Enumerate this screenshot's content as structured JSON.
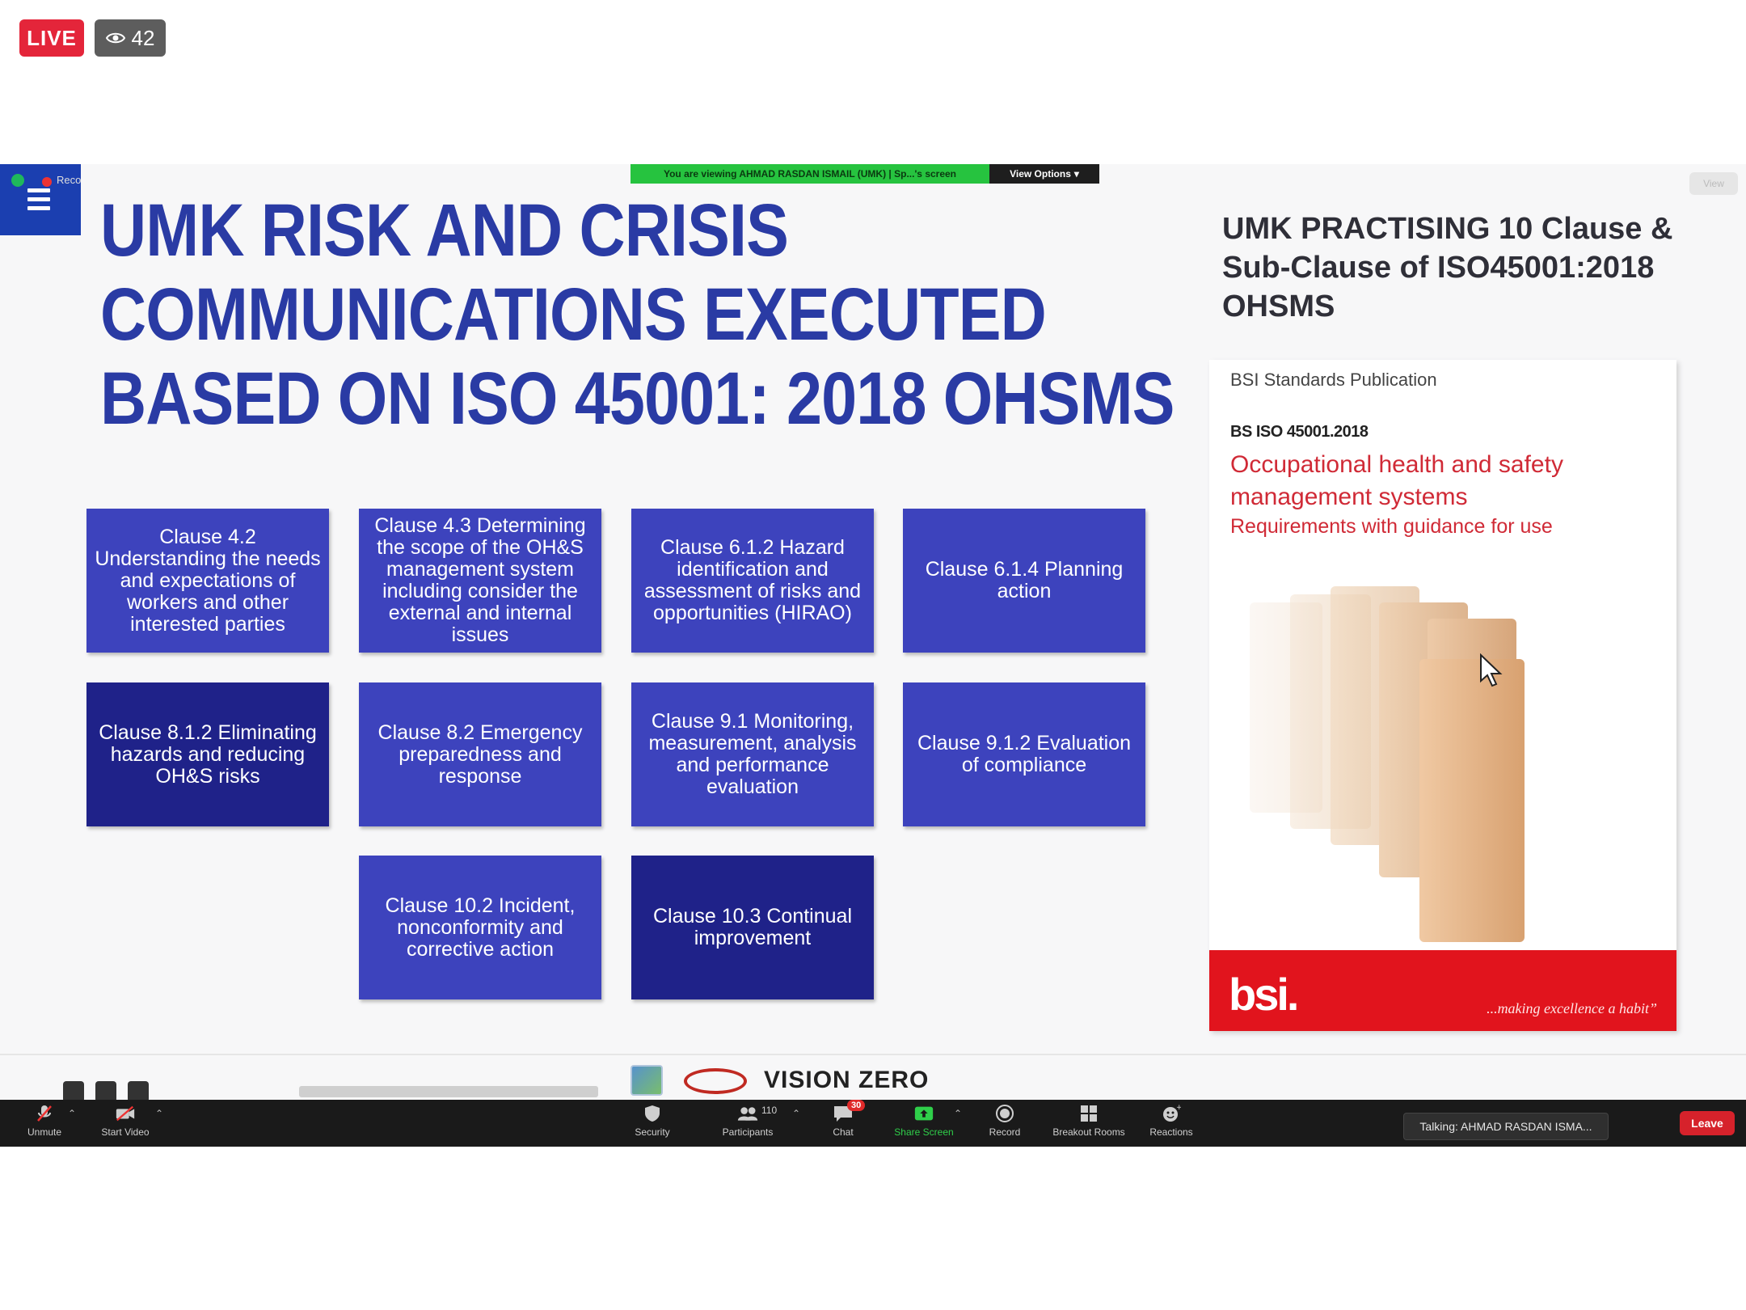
{
  "live": {
    "label": "LIVE",
    "viewers": "42"
  },
  "zoom": {
    "recording_label": "Reco",
    "viewing_banner": "You are viewing AHMAD RASDAN ISMAIL (UMK) | Sp...'s screen",
    "view_options": "View Options",
    "view_button": "View"
  },
  "slide": {
    "title_lines": [
      "UMK RISK AND CRISIS",
      "COMMUNICATIONS EXECUTED",
      "BASED ON  ISO 45001: 2018 OHSMS"
    ],
    "clauses": [
      "Clause 4.2 Understanding the needs and expectations of workers and other interested parties",
      "Clause 4.3 Determining the scope of the OH&S management system including consider the external and internal issues",
      "Clause 6.1.2 Hazard identification and assessment of risks and opportunities (HIRAO)",
      "Clause 6.1.4 Planning action",
      "Clause 8.1.2 Eliminating hazards and reducing OH&S risks",
      "Clause 8.2 Emergency preparedness and response",
      "Clause 9.1 Monitoring, measurement, analysis and performance evaluation",
      "Clause 9.1.2 Evaluation of compliance",
      "Clause 10.2 Incident, nonconformity and corrective action",
      "Clause 10.3 Continual improvement"
    ],
    "right_title": "UMK PRACTISING 10 Clause & Sub-Clause of ISO45001:2018 OHSMS",
    "cover": {
      "publication": "BSI Standards Publication",
      "code": "BS ISO 45001.2018",
      "title": "Occupational health and safety management systems",
      "subtitle": "Requirements with guidance for use",
      "logo": "bsi.",
      "tagline": "...making excellence a habit”"
    },
    "footer": {
      "vision": "VISION ZERO"
    }
  },
  "toolbar": {
    "unmute": "Unmute",
    "start_video": "Start Video",
    "security": "Security",
    "participants": "Participants",
    "participants_count": "110",
    "chat": "Chat",
    "chat_badge": "30",
    "share_screen": "Share Screen",
    "record": "Record",
    "breakout_rooms": "Breakout Rooms",
    "reactions": "Reactions",
    "talking": "Talking: AHMAD RASDAN ISMA...",
    "leave": "Leave"
  },
  "colors": {
    "live_red": "#e4253a",
    "title_blue": "#2a3ba4",
    "clause_light": "#3d43bd",
    "clause_dark": "#1f2289",
    "bsi_red": "#e1141d",
    "share_green": "#2fcf4a"
  },
  "icons": [
    "eye-icon",
    "menu-icon",
    "shield-icon",
    "microphone-muted-icon",
    "video-off-icon",
    "security-shield-icon",
    "participants-icon",
    "chat-icon",
    "share-screen-icon",
    "record-icon",
    "breakout-rooms-icon",
    "reactions-icon",
    "cursor-icon"
  ]
}
